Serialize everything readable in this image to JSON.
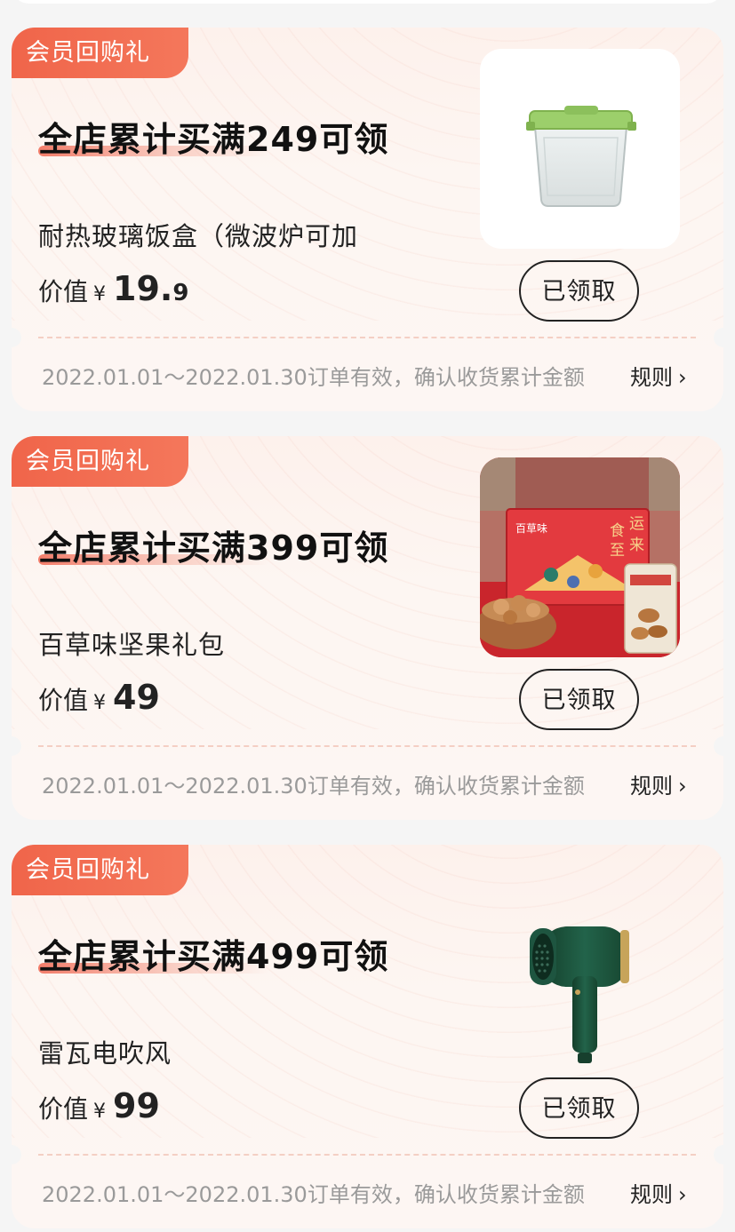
{
  "cards": [
    {
      "badge": "会员回购礼",
      "title": "全店累计买满249可领",
      "product_name": "耐热玻璃饭盒（微波炉可加",
      "price_label": "价值",
      "currency": "¥",
      "price_int": "19.",
      "price_dec": "9",
      "button": "已领取",
      "validity": "2022.01.01～2022.01.30订单有效，确认收货累计金额",
      "rules": "规则",
      "image_icon": "glass-food-box-icon"
    },
    {
      "badge": "会员回购礼",
      "title": "全店累计买满399可领",
      "product_name": "百草味坚果礼包",
      "price_label": "价值",
      "currency": "¥",
      "price_int": "49",
      "price_dec": "",
      "button": "已领取",
      "validity": "2022.01.01～2022.01.30订单有效，确认收货累计金额",
      "rules": "规则",
      "image_icon": "nut-gift-box-icon",
      "image_text": {
        "brand": "百草味",
        "slogan_1": "食",
        "slogan_2": "运",
        "slogan_3": "至",
        "slogan_4": "来"
      }
    },
    {
      "badge": "会员回购礼",
      "title": "全店累计买满499可领",
      "product_name": "雷瓦电吹风",
      "price_label": "价值",
      "currency": "¥",
      "price_int": "99",
      "price_dec": "",
      "button": "已领取",
      "validity": "2022.01.01～2022.01.30订单有效，确认收货累计金额",
      "rules": "规则",
      "image_icon": "hair-dryer-icon"
    }
  ],
  "colors": {
    "badge": "#f0654a",
    "card_bg": "#fdf6f2",
    "page_bg": "#f5f5f5",
    "hair_dryer": "#1f5a3e",
    "lid_green": "#9ccf6b"
  }
}
